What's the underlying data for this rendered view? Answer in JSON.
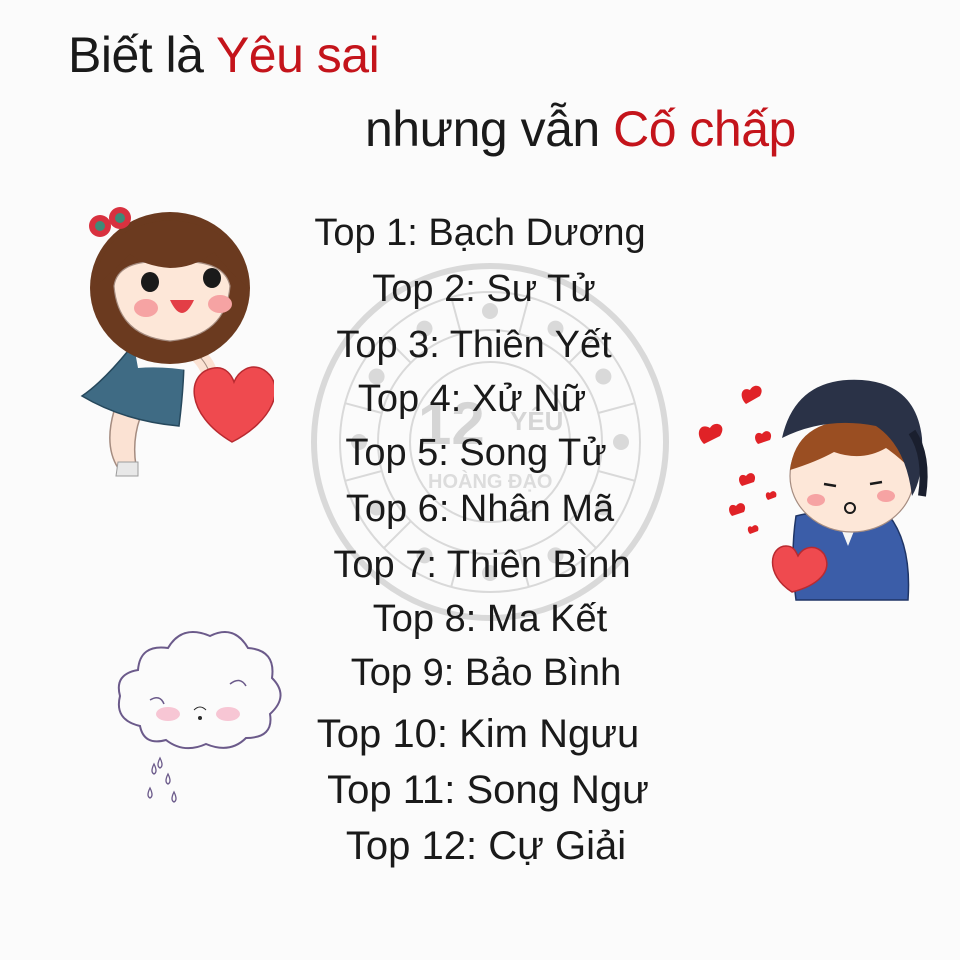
{
  "title": {
    "line1_prefix": "Biết là ",
    "line1_highlight": "Yêu sai",
    "line2_prefix": "nhưng vẫn ",
    "line2_highlight": "Cố chấp"
  },
  "colors": {
    "highlight": "#c4141b",
    "text": "#1a1a1a",
    "watermark": "#d9d9d9"
  },
  "ranking": [
    "Top 1: Bạch Dương",
    "Top 2: Sư Tử",
    "Top 3: Thiên Yết",
    "Top 4: Xử Nữ",
    "Top 5: Song Tử",
    "Top 6: Nhân Mã",
    "Top 7: Thiên Bình",
    "Top 8: Ma Kết",
    "Top 9: Bảo Bình",
    "Top 10: Kim Ngưu",
    "Top 11: Song Ngư",
    "Top 12: Cự Giải"
  ],
  "watermark": {
    "number": "12",
    "word": "YÊU",
    "arc_text": "HOÀNG ĐẠO"
  },
  "stickers": {
    "girl": "girl-with-heart",
    "boy": "boy-with-cap-blowing-hearts",
    "cloud": "sad-rain-cloud"
  }
}
